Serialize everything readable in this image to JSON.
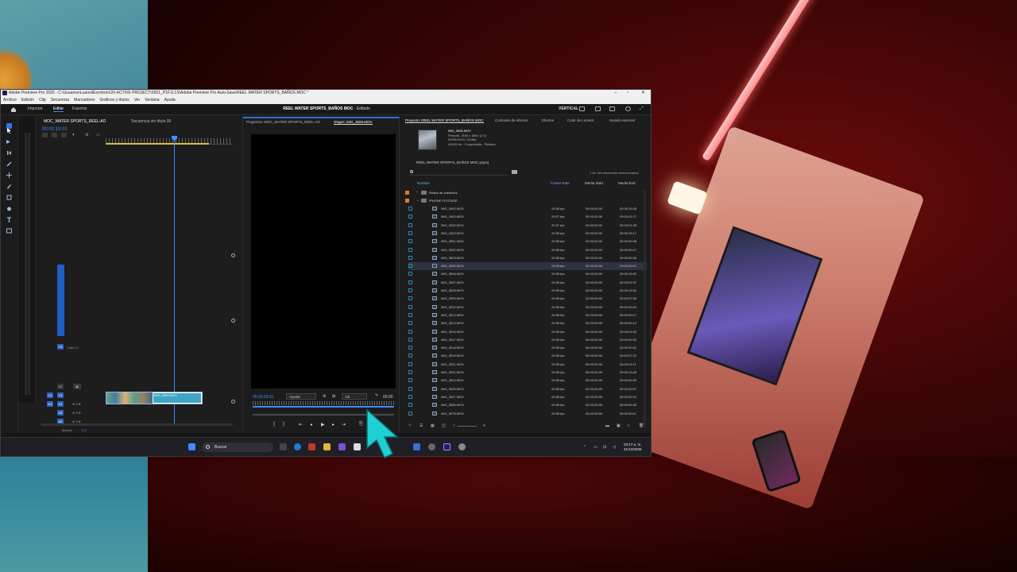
{
  "window": {
    "title": "Adobe Premiere Pro 2025 - C:\\Usuarios\\Luanni\\Escritorio\\20-ACTIVE PROJECT\\0001_P1F1L1S\\Adobe Premiere Pro Auto-Save\\REEL WATER SPORTS_BAÑOS MOC *",
    "menus": [
      "Archivo",
      "Edición",
      "Clip",
      "Secuencia",
      "Marcadores",
      "Gráficos y títulos",
      "Ver",
      "Ventana",
      "Ayuda"
    ]
  },
  "workspace": {
    "tabs": [
      "Importar",
      "Editar",
      "Exportar"
    ],
    "active_tab": "Editar",
    "project_title": "REEL WATER SPORTS_BAÑOS MOC",
    "project_status": "- Editado",
    "layout_label": "VERTICAL"
  },
  "timeline": {
    "tab_sequence": "MOC_WATER SPORTS_REEL-AD",
    "tab_unnamed": "Secuencia sin título 06",
    "timecode": "00:00:13:01",
    "tracks": {
      "v3": "V3",
      "v2": "V2",
      "v1": "V1",
      "a1": "A1",
      "a2": "A2",
      "a3": "A3",
      "video_label": "Vídeo 3",
      "mix_label": "Mezcla",
      "mix_value": "0.0"
    },
    "clip_name": "IMG_3505.MOV"
  },
  "monitor": {
    "tab_program": "Programa: MOC_WATER SPORTS_REEL-AD",
    "tab_source": "Origen: IMG_3505.MOV",
    "timecode": "00:00:03:01",
    "fit": "Ajustar",
    "resolution": "1/2",
    "duration": "00:00"
  },
  "project": {
    "tabs": [
      "Proyecto: REEL WATER SPORTS_BAÑOS MOC",
      "Controles de efectos",
      "Efectos",
      "Color de Lumetri",
      "Sonido esencial"
    ],
    "clip_info": {
      "name": "IMG_3505.MOV",
      "type": "Película, 2160 x 3840 (1.0)",
      "timing": "00:00:09:01, 29,98p",
      "audio": "44100 Hz - Comprimido - Estéreo"
    },
    "path": "REEL WATER SPORTS_BAÑOS MOC.prproj",
    "selection_count": "1 de 145 elementos seleccionados",
    "columns": {
      "name": "Nombre",
      "frame_rate": "Frame Rate",
      "media_start": "Media Start",
      "media_end": "Media End"
    },
    "folders": [
      {
        "name": "Estilos de subtítulos"
      },
      {
        "name": "IPHONE FOOTAGE"
      }
    ],
    "rows": [
      {
        "name": "IMG_3492.MOV",
        "fr": "29,98 fps",
        "ms": "00:00:00:00",
        "me": "00:00:15:28"
      },
      {
        "name": "IMG_3493.MOV",
        "fr": "29,97 fps",
        "ms": "00:00:00:00",
        "me": "00:00:01:17"
      },
      {
        "name": "IMG_3500.MOV",
        "fr": "29,97 fps",
        "ms": "00:00:00:00",
        "me": "00:00:01:28"
      },
      {
        "name": "IMG_3453.MOV",
        "fr": "29,98 fps",
        "ms": "00:00:00:00",
        "me": "00:00:28:17"
      },
      {
        "name": "IMG_3501.MOV",
        "fr": "29,98 fps",
        "ms": "00:00:00:00",
        "me": "00:00:05:08"
      },
      {
        "name": "IMG_3502.MOV",
        "fr": "29,98 fps",
        "ms": "00:00:00:00",
        "me": "00:00:05:27"
      },
      {
        "name": "IMG_3503.MOV",
        "fr": "29,98 fps",
        "ms": "00:00:00:00",
        "me": "00:00:09:28"
      },
      {
        "name": "IMG_3505.MOV",
        "fr": "29,98 fps",
        "ms": "00:00:00:00",
        "me": "00:00:09:01"
      },
      {
        "name": "IMG_3506.MOV",
        "fr": "29,98 fps",
        "ms": "00:00:00:00",
        "me": "00:00:19:29"
      },
      {
        "name": "IMG_3507.MOV",
        "fr": "29,98 fps",
        "ms": "00:00:00:00",
        "me": "00:00:01:07"
      },
      {
        "name": "IMG_3508.MOV",
        "fr": "29,98 fps",
        "ms": "00:00:00:00",
        "me": "00:00:14:00"
      },
      {
        "name": "IMG_3509.MOV",
        "fr": "29,98 fps",
        "ms": "00:00:00:00",
        "me": "00:00:07:08"
      },
      {
        "name": "IMG_3510.MOV",
        "fr": "29,98 fps",
        "ms": "00:00:00:00",
        "me": "00:00:26:04"
      },
      {
        "name": "IMG_3512.MOV",
        "fr": "29,98 fps",
        "ms": "00:00:00:00",
        "me": "00:00:09:17"
      },
      {
        "name": "IMG_3514.MOV",
        "fr": "29,98 fps",
        "ms": "00:00:00:00",
        "me": "00:00:05:12"
      },
      {
        "name": "IMG_3516.MOV",
        "fr": "29,98 fps",
        "ms": "00:00:00:00",
        "me": "00:00:04:03"
      },
      {
        "name": "IMG_3517.MOV",
        "fr": "29,98 fps",
        "ms": "00:00:00:00",
        "me": "00:00:09:00"
      },
      {
        "name": "IMG_3518.MOV",
        "fr": "29,98 fps",
        "ms": "00:00:00:00",
        "me": "00:00:20:02"
      },
      {
        "name": "IMG_3519.MOV",
        "fr": "29,98 fps",
        "ms": "00:00:00:00",
        "me": "00:00:07:22"
      },
      {
        "name": "IMG_3521.MOV",
        "fr": "29,98 fps",
        "ms": "00:00:00:00",
        "me": "00:00:24:11"
      },
      {
        "name": "IMG_3522.MOV",
        "fr": "29,98 fps",
        "ms": "00:00:00:00",
        "me": "00:00:13:28"
      },
      {
        "name": "IMG_3524.MOV",
        "fr": "29,98 fps",
        "ms": "00:00:00:00",
        "me": "00:00:06:09"
      },
      {
        "name": "IMG_3525.MOV",
        "fr": "29,98 fps",
        "ms": "00:00:00:00",
        "me": "00:00:22:07"
      },
      {
        "name": "IMG_3527.MOV",
        "fr": "29,98 fps",
        "ms": "00:00:00:00",
        "me": "00:00:02:21"
      },
      {
        "name": "IMG_3556.MOV",
        "fr": "29,98 fps",
        "ms": "00:00:00:00",
        "me": "00:00:05:25"
      },
      {
        "name": "IMG_3576.MOV",
        "fr": "29,98 fps",
        "ms": "00:00:00:00",
        "me": "00:00:00:11"
      }
    ],
    "selected_index": 7
  },
  "taskbar": {
    "search_label": "Buscar",
    "time": "03:17 a. m.",
    "date": "31/12/2025"
  },
  "colors": {
    "accent": "#3d8cff",
    "track_blue": "#2c62c8",
    "clip_selected": "#3fa5c4",
    "folder_label": "#e07b2a"
  }
}
